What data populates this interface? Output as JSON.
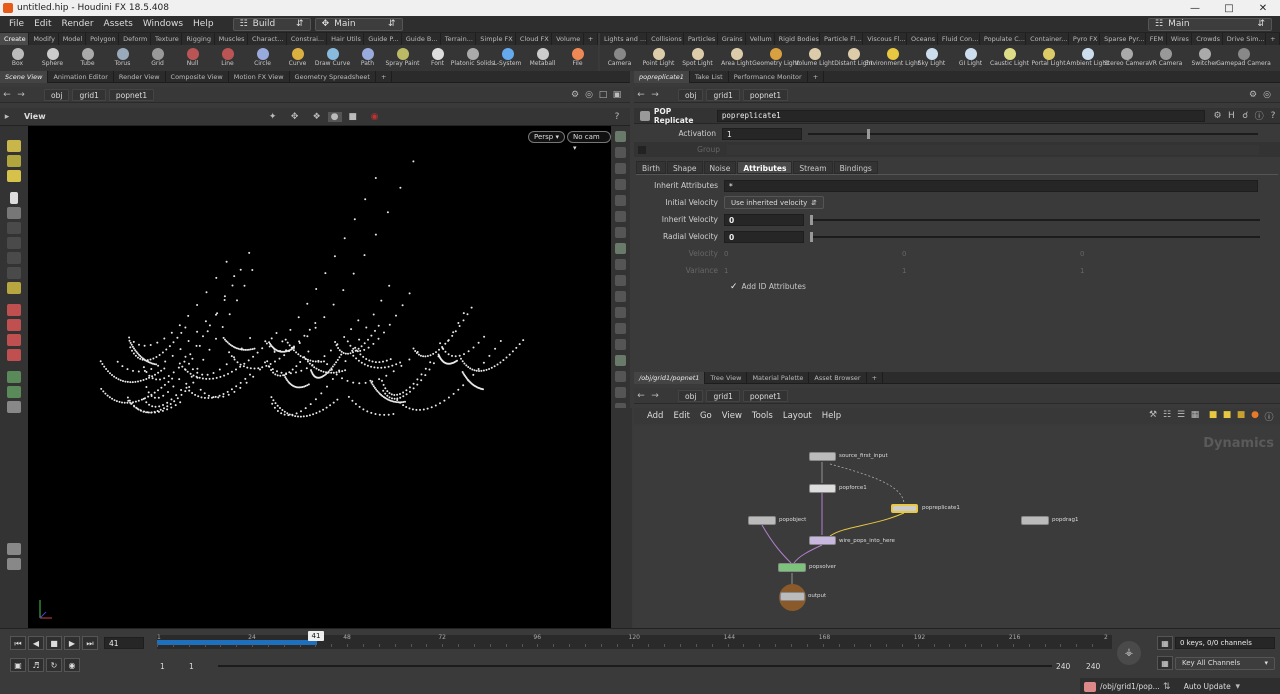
{
  "window": {
    "title": "untitled.hip - Houdini FX 18.5.408"
  },
  "menu": {
    "items": [
      "File",
      "Edit",
      "Render",
      "Assets",
      "Windows",
      "Help"
    ],
    "desktop": "Build",
    "context": "Main",
    "right_desktop": "Main"
  },
  "shelf_left": {
    "tabs": [
      "Create",
      "Modify",
      "Model",
      "Polygon",
      "Deform",
      "Texture",
      "Rigging",
      "Muscles",
      "Charact...",
      "Constrai...",
      "Hair Utils",
      "Guide P...",
      "Guide B...",
      "Terrain...",
      "Simple FX",
      "Cloud FX",
      "Volume"
    ],
    "tools": [
      "Box",
      "Sphere",
      "Tube",
      "Torus",
      "Grid",
      "Null",
      "Line",
      "Circle",
      "Curve",
      "Draw Curve",
      "Path",
      "Spray Paint",
      "Font",
      "Platonic Solids",
      "L-System",
      "Metaball",
      "File"
    ]
  },
  "shelf_right": {
    "tabs": [
      "Lights and ...",
      "Collisions",
      "Particles",
      "Grains",
      "Vellum",
      "Rigid Bodies",
      "Particle Fl...",
      "Viscous Fl...",
      "Oceans",
      "Fluid Con...",
      "Populate C...",
      "Container...",
      "Pyro FX",
      "Sparse Pyr...",
      "FEM",
      "Wires",
      "Crowds",
      "Drive Sim..."
    ],
    "tools": [
      "Camera",
      "Point Light",
      "Spot Light",
      "Area Light",
      "Geometry Light",
      "Volume Light",
      "Distant Light",
      "Environment Light",
      "Sky Light",
      "GI Light",
      "Caustic Light",
      "Portal Light",
      "Ambient Light",
      "Stereo Camera",
      "VR Camera",
      "Switcher",
      "Gamepad Camera"
    ]
  },
  "left_pane": {
    "tabs": [
      "Scene View",
      "Animation Editor",
      "Render View",
      "Composite View",
      "Motion FX View",
      "Geometry Spreadsheet"
    ],
    "path": [
      "obj",
      "grid1",
      "popnet1"
    ],
    "view_label": "View",
    "persp": "Persp ▾",
    "cam": "No cam ▾"
  },
  "param_pane": {
    "tabs": [
      "popreplicate1",
      "Take List",
      "Performance Monitor"
    ],
    "path": [
      "obj",
      "grid1",
      "popnet1"
    ],
    "node_type": "POP Replicate",
    "node_name": "popreplicate1",
    "activation_label": "Activation",
    "activation_value": "1",
    "activation_slider": 0.13,
    "group_label": "Group",
    "subtabs": [
      "Birth",
      "Shape",
      "Noise",
      "Attributes",
      "Stream",
      "Bindings"
    ],
    "inherit_attributes_label": "Inherit Attributes",
    "inherit_attributes_value": "*",
    "initial_velocity_label": "Initial Velocity",
    "initial_velocity_value": "Use inherited velocity",
    "inherit_velocity_label": "Inherit Velocity",
    "inherit_velocity_value": "0",
    "radial_velocity_label": "Radial Velocity",
    "radial_velocity_value": "0",
    "velocity_label": "Velocity",
    "velocity_values": [
      "0",
      "0",
      "0"
    ],
    "variance_label": "Variance",
    "variance_values": [
      "1",
      "1",
      "1"
    ],
    "add_id_label": "Add ID Attributes"
  },
  "network_pane": {
    "tabs": [
      "/obj/grid1/popnet1",
      "Tree View",
      "Material Palette",
      "Asset Browser"
    ],
    "path": [
      "obj",
      "grid1",
      "popnet1"
    ],
    "menu": [
      "Add",
      "Edit",
      "Go",
      "View",
      "Tools",
      "Layout",
      "Help"
    ],
    "context_label": "Dynamics",
    "nodes": {
      "source_first_input": "source_first_input",
      "popforce1": "popforce1",
      "popreplicate1": "popreplicate1",
      "popobject": "popobject",
      "popdrag1": "popdrag1",
      "wire_pops_into_here": "wire_pops_into_here",
      "popsolver": "popsolver",
      "output": "output"
    }
  },
  "timeline": {
    "current_frame": "41",
    "start": "1",
    "end": "240",
    "range_start": "1",
    "range_start2": "1",
    "range_end": "240",
    "range_end2": "240",
    "ticks": [
      "1",
      "24",
      "48",
      "72",
      "96",
      "120",
      "144",
      "168",
      "192",
      "216",
      "2"
    ],
    "keys_label": "0 keys, 0/0 channels",
    "channels_label": "Key All Channels",
    "status_path": "/obj/grid1/pop...",
    "update_mode": "Auto Update"
  },
  "colors": {
    "accent": "#1f6fbf",
    "selected_node": "#e8c840",
    "solver": "#7cc47c"
  }
}
